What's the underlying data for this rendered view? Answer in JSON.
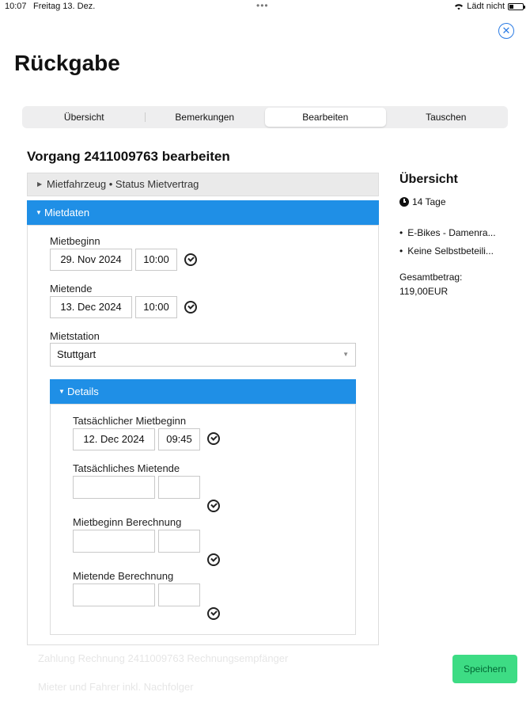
{
  "statusbar": {
    "time": "10:07",
    "date": "Freitag 13. Dez.",
    "battery_label": "Lädt nicht"
  },
  "header": {
    "title": "Rückgabe"
  },
  "tabs": [
    {
      "label": "Übersicht"
    },
    {
      "label": "Bemerkungen"
    },
    {
      "label": "Bearbeiten"
    },
    {
      "label": "Tauschen"
    }
  ],
  "active_tab": "Bearbeiten",
  "form": {
    "heading": "Vorgang 2411009763 bearbeiten",
    "section_vehicle": "Mietfahrzeug • Status Mietvertrag",
    "section_rental": "Mietdaten",
    "mietbeginn": {
      "label": "Mietbeginn",
      "date": "29. Nov 2024",
      "time": "10:00"
    },
    "mietende": {
      "label": "Mietende",
      "date": "13. Dec 2024",
      "time": "10:00"
    },
    "mietstation": {
      "label": "Mietstation",
      "value": "Stuttgart"
    },
    "details": {
      "title": "Details",
      "actual_start": {
        "label": "Tatsächlicher Mietbeginn",
        "date": "12. Dec 2024",
        "time": "09:45"
      },
      "actual_end": {
        "label": "Tatsächliches Mietende",
        "date": "",
        "time": ""
      },
      "calc_start": {
        "label": "Mietbeginn Berechnung",
        "date": "",
        "time": ""
      },
      "calc_end": {
        "label": "Mietende Berechnung",
        "date": "",
        "time": ""
      }
    },
    "faded_1": "Zahlung Rechnung 2411009763 Rechnungsempfänger",
    "faded_2": "Mieter und Fahrer inkl. Nachfolger"
  },
  "sidebar": {
    "title": "Übersicht",
    "duration": "14 Tage",
    "items": [
      "E-Bikes - Damenra...",
      "Keine Selbstbeteili..."
    ],
    "total_label": "Gesamtbetrag:",
    "total_value": "119,00EUR"
  },
  "actions": {
    "save_label": "Speichern"
  }
}
